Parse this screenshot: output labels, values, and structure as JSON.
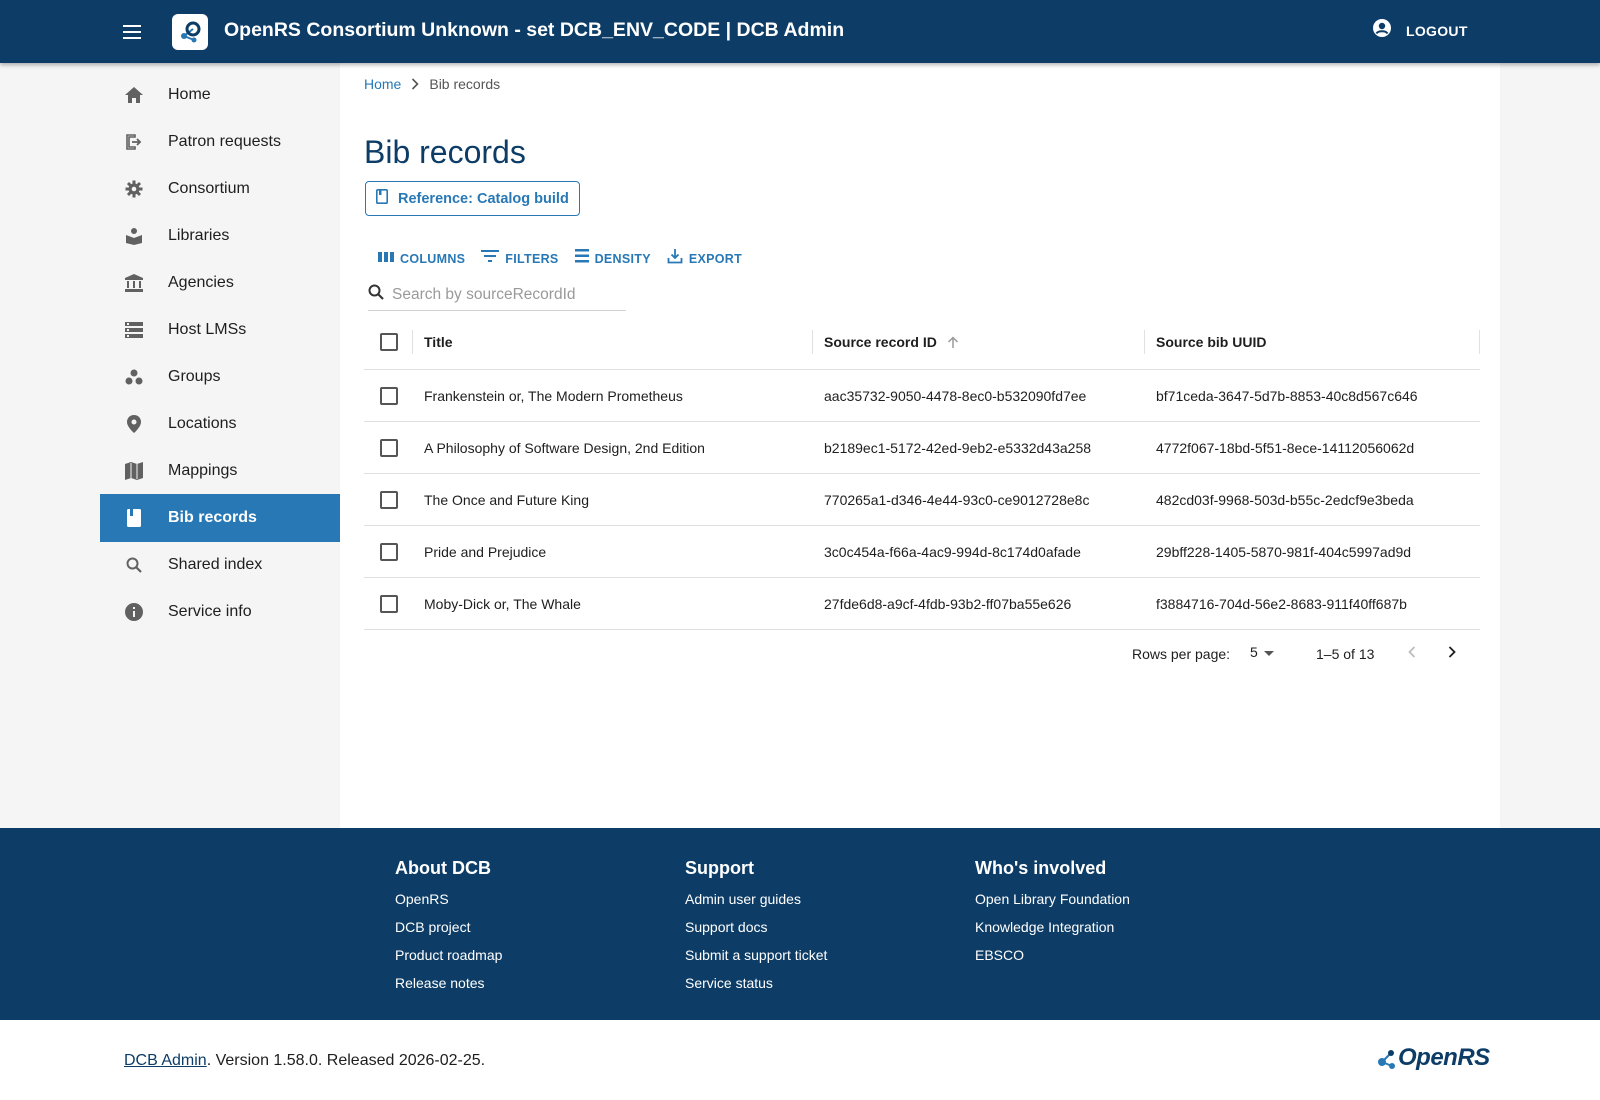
{
  "header": {
    "title": "OpenRS Consortium Unknown - set DCB_ENV_CODE | DCB Admin",
    "logout_label": "LOGOUT",
    "icons": {
      "menu": "menu-icon",
      "logo": "openrs-logo-icon",
      "account": "account-circle-icon"
    }
  },
  "sidebar": {
    "items": [
      {
        "label": "Home",
        "icon": "home-icon"
      },
      {
        "label": "Patron requests",
        "icon": "exit-to-app-icon"
      },
      {
        "label": "Consortium",
        "icon": "gear-icon"
      },
      {
        "label": "Libraries",
        "icon": "library-icon"
      },
      {
        "label": "Agencies",
        "icon": "bank-icon"
      },
      {
        "label": "Host LMSs",
        "icon": "storage-icon"
      },
      {
        "label": "Groups",
        "icon": "workspaces-icon"
      },
      {
        "label": "Locations",
        "icon": "location-pin-icon"
      },
      {
        "label": "Mappings",
        "icon": "map-icon"
      },
      {
        "label": "Bib records",
        "icon": "book-icon",
        "active": true
      },
      {
        "label": "Shared index",
        "icon": "search-icon"
      },
      {
        "label": "Service info",
        "icon": "info-icon"
      }
    ],
    "active_color": "#2878b5"
  },
  "breadcrumb": {
    "home": "Home",
    "current": "Bib records"
  },
  "page": {
    "title": "Bib records",
    "reference_button": "Reference: Catalog build"
  },
  "toolbar": {
    "columns": "COLUMNS",
    "filters": "FILTERS",
    "density": "DENSITY",
    "export": "EXPORT"
  },
  "search": {
    "placeholder": "Search by sourceRecordId",
    "value": ""
  },
  "table": {
    "columns": [
      "Title",
      "Source record ID",
      "Source bib UUID"
    ],
    "sorted_column": "Source record ID",
    "sort_direction": "ascending",
    "rows": [
      {
        "title": "Frankenstein or, The Modern Prometheus",
        "source_record_id": "aac35732-9050-4478-8ec0-b532090fd7ee",
        "source_bib_uuid": "bf71ceda-3647-5d7b-8853-40c8d567c646"
      },
      {
        "title": "A Philosophy of Software Design, 2nd Edition",
        "source_record_id": "b2189ec1-5172-42ed-9eb2-e5332d43a258",
        "source_bib_uuid": "4772f067-18bd-5f51-8ece-14112056062d"
      },
      {
        "title": "The Once and Future King",
        "source_record_id": "770265a1-d346-4e44-93c0-ce9012728e8c",
        "source_bib_uuid": "482cd03f-9968-503d-b55c-2edcf9e3beda"
      },
      {
        "title": "Pride and Prejudice",
        "source_record_id": "3c0c454a-f66a-4ac9-994d-8c174d0afade",
        "source_bib_uuid": "29bff228-1405-5870-981f-404c5997ad9d"
      },
      {
        "title": "Moby-Dick or, The Whale",
        "source_record_id": "27fde6d8-a9cf-4fdb-93b2-ff07ba55e626",
        "source_bib_uuid": "f3884716-704d-56e2-8683-911f40ff687b"
      }
    ]
  },
  "pagination": {
    "rows_per_page_label": "Rows per page:",
    "rows_per_page": "5",
    "range": "1–5 of 13"
  },
  "footer": {
    "columns": [
      {
        "heading": "About DCB",
        "links": [
          "OpenRS",
          "DCB project",
          "Product roadmap",
          "Release notes"
        ]
      },
      {
        "heading": "Support",
        "links": [
          "Admin user guides",
          "Support docs",
          "Submit a support ticket",
          "Service status"
        ]
      },
      {
        "heading": "Who's involved",
        "links": [
          "Open Library Foundation",
          "Knowledge Integration",
          "EBSCO"
        ]
      }
    ]
  },
  "bottom": {
    "app_link": "DCB Admin",
    "version_text": ". Version 1.58.0. Released 2026-02-25.",
    "brand": "OpenRS"
  },
  "colors": {
    "primary_dark": "#0d3d66",
    "primary": "#2878b5"
  }
}
